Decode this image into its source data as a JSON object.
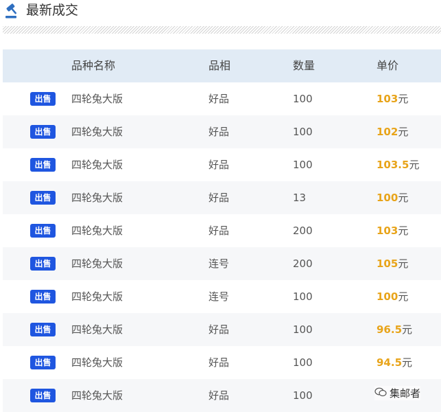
{
  "header": {
    "title": "最新成交"
  },
  "table": {
    "columns": [
      "品种名称",
      "品相",
      "数量",
      "单价"
    ],
    "rows": [
      {
        "type": "出售",
        "name": "四轮兔大版",
        "grade": "好品",
        "qty": "100",
        "price": "103",
        "unit": "元"
      },
      {
        "type": "出售",
        "name": "四轮兔大版",
        "grade": "好品",
        "qty": "100",
        "price": "102",
        "unit": "元"
      },
      {
        "type": "出售",
        "name": "四轮兔大版",
        "grade": "好品",
        "qty": "100",
        "price": "103.5",
        "unit": "元"
      },
      {
        "type": "出售",
        "name": "四轮兔大版",
        "grade": "好品",
        "qty": "13",
        "price": "100",
        "unit": "元"
      },
      {
        "type": "出售",
        "name": "四轮兔大版",
        "grade": "好品",
        "qty": "200",
        "price": "103",
        "unit": "元"
      },
      {
        "type": "出售",
        "name": "四轮兔大版",
        "grade": "连号",
        "qty": "200",
        "price": "105",
        "unit": "元"
      },
      {
        "type": "出售",
        "name": "四轮兔大版",
        "grade": "连号",
        "qty": "100",
        "price": "100",
        "unit": "元"
      },
      {
        "type": "出售",
        "name": "四轮兔大版",
        "grade": "好品",
        "qty": "100",
        "price": "96.5",
        "unit": "元"
      },
      {
        "type": "出售",
        "name": "四轮兔大版",
        "grade": "好品",
        "qty": "100",
        "price": "94.5",
        "unit": "元"
      },
      {
        "type": "出售",
        "name": "四轮兔大版",
        "grade": "好品",
        "qty": "100",
        "price": "",
        "unit": ""
      }
    ]
  },
  "watermark": {
    "text": "集邮者",
    "icon": "wechat-icon"
  },
  "colors": {
    "badge": "#1f56e0",
    "price": "#e8a41a",
    "header_bg": "#e1ebf5"
  }
}
